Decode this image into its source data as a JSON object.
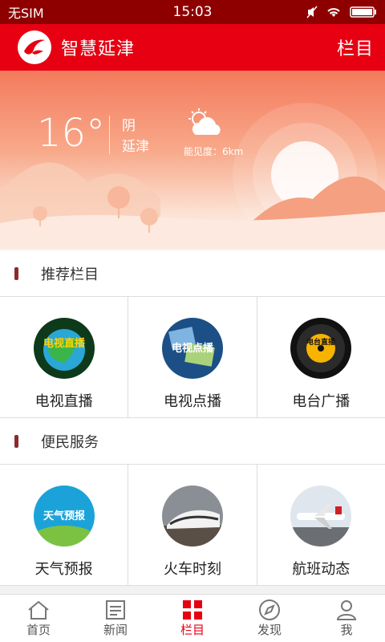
{
  "status": {
    "carrier": "无SIM",
    "time": "15:03"
  },
  "appbar": {
    "title": "智慧延津",
    "column_button": "栏目"
  },
  "weather": {
    "temperature": "16°",
    "condition": "阴",
    "location": "延津",
    "visibility": "能见度：6km"
  },
  "sections": [
    {
      "title": "推荐栏目",
      "items": [
        {
          "label": "电视直播",
          "thumb_text": "电视直播"
        },
        {
          "label": "电视点播",
          "thumb_text": "电视点播"
        },
        {
          "label": "电台广播",
          "thumb_text": "电台直播"
        }
      ]
    },
    {
      "title": "便民服务",
      "items": [
        {
          "label": "天气预报",
          "thumb_text": "天气预报"
        },
        {
          "label": "火车时刻",
          "thumb_text": ""
        },
        {
          "label": "航班动态",
          "thumb_text": ""
        }
      ]
    }
  ],
  "tabs": [
    {
      "label": "首页",
      "icon": "home-icon"
    },
    {
      "label": "新闻",
      "icon": "news-icon"
    },
    {
      "label": "栏目",
      "icon": "grid-icon",
      "active": true
    },
    {
      "label": "发现",
      "icon": "compass-icon"
    },
    {
      "label": "我",
      "icon": "user-icon"
    }
  ],
  "colors": {
    "brand_red": "#e60012",
    "status_bar": "#8e0000",
    "section_mark": "#8b2b2b"
  }
}
